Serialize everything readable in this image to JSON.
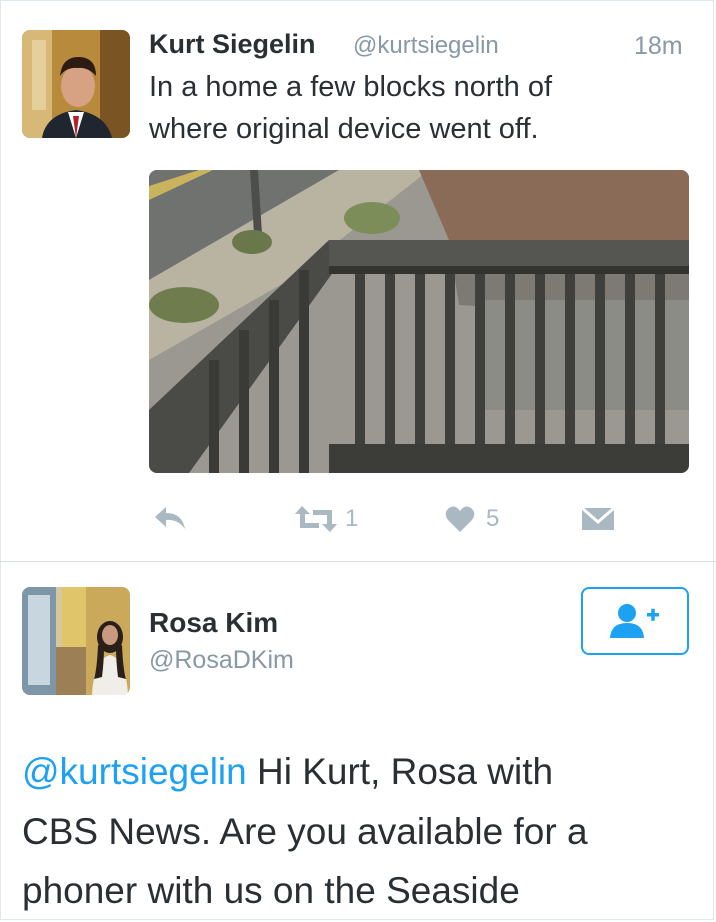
{
  "tweet": {
    "author_name": "Kurt Siegelin",
    "author_handle": "@kurtsiegelin",
    "timestamp": "18m",
    "text_line1": "In a home a few blocks north of",
    "text_line2": "where original device went off.",
    "actions": {
      "reply_icon": "reply-icon",
      "retweet_icon": "retweet-icon",
      "retweet_count": "1",
      "like_icon": "heart-icon",
      "like_count": "5",
      "dm_icon": "envelope-icon"
    }
  },
  "reply": {
    "author_name": "Rosa Kim",
    "author_handle": "@RosaDKim",
    "follow_icon": "add-user-icon",
    "mention": "@kurtsiegelin",
    "text_line1_rest": " Hi Kurt, Rosa with",
    "text_line2": "CBS News. Are you available for a",
    "text_line3": "phoner with us on the Seaside"
  },
  "colors": {
    "accent": "#1da1f2",
    "muted": "#8899a6",
    "icon": "#aab8c2",
    "text": "#292f33"
  }
}
